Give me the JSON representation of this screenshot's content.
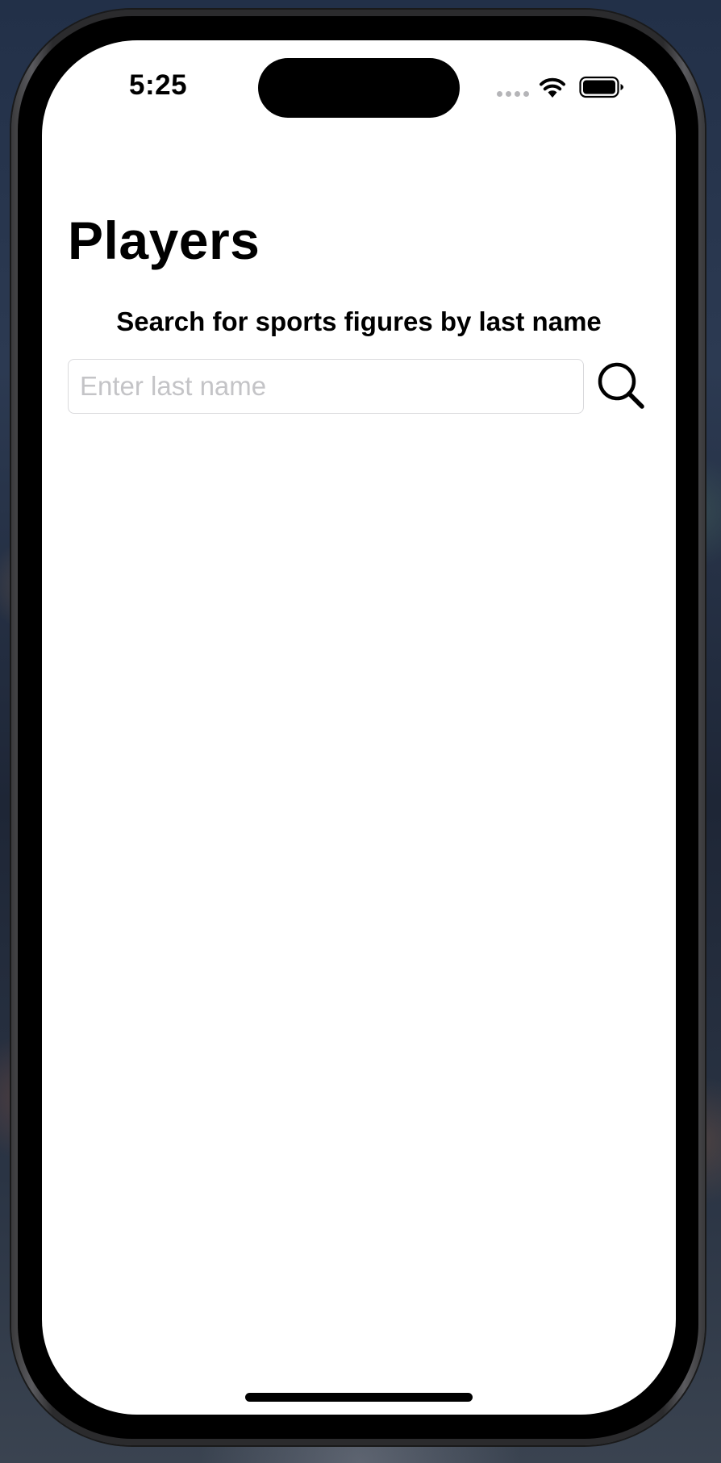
{
  "status_bar": {
    "time": "5:25",
    "icons": [
      "cellular-dots-icon",
      "wifi-icon",
      "battery-icon"
    ]
  },
  "header": {
    "title": "Players"
  },
  "search": {
    "instruction": "Search for sports figures by last name",
    "placeholder": "Enter last name",
    "value": "",
    "button_icon": "search-icon"
  },
  "colors": {
    "screen_background": "#ffffff",
    "text": "#000000",
    "placeholder": "#c4c4c7",
    "input_border": "#d9d9dc"
  }
}
